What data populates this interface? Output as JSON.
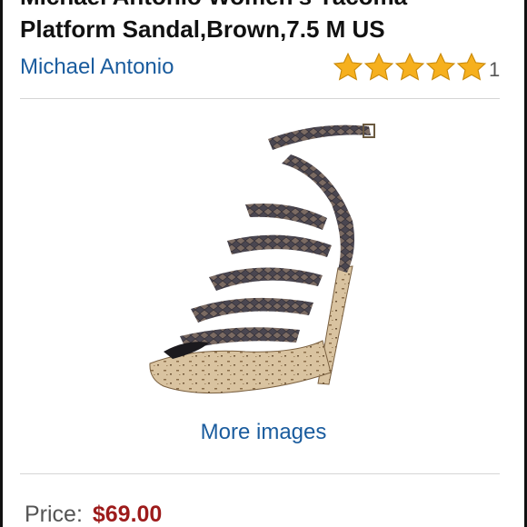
{
  "product": {
    "title_line1": "Michael Antonio Women's Yacoma",
    "title_line2": "Platform Sandal,Brown,7.5 M US",
    "brand": "Michael Antonio",
    "rating_stars": 5,
    "rating_max": 5,
    "rating_count": "1",
    "image_alt_icon": "sandal-product-image",
    "more_images_label": "More images",
    "price_label": "Price:",
    "price_value": "$69.00"
  },
  "colors": {
    "link": "#1a5c9e",
    "price": "#9d1b1b",
    "star": "#f6b01e"
  }
}
